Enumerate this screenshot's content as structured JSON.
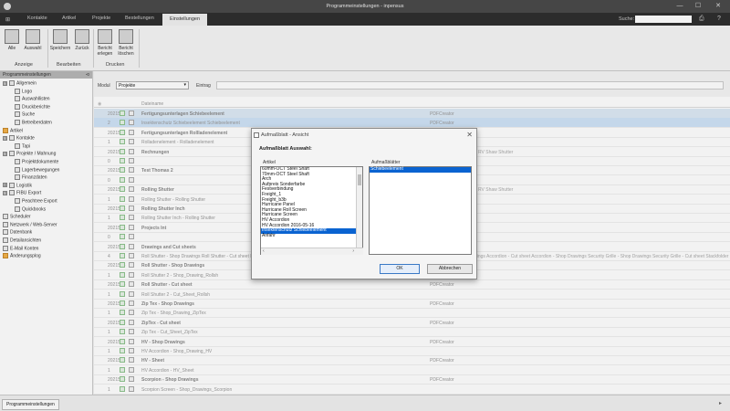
{
  "window": {
    "title": "Programmeinstellungen - inpensus",
    "min": "—",
    "max": "☐",
    "close": "✕"
  },
  "menu": {
    "tabs": [
      "Kontakte",
      "Artikel",
      "Projekte",
      "Bestellungen",
      "Einstellungen"
    ],
    "active_tab": "Einstellungen",
    "search_label": "Suche:",
    "search_value": ""
  },
  "ribbon": {
    "buttons": [
      {
        "label": "Alle"
      },
      {
        "label": "Auswahl"
      },
      {
        "label": "Speichern"
      },
      {
        "label": "Zurück"
      },
      {
        "label": "Bericht erlegen"
      },
      {
        "label": "Bericht löschen"
      }
    ],
    "groups": [
      "Anzeige",
      "Bearbeiten",
      "Drucken"
    ]
  },
  "sidebar": {
    "header": "Programmeinstellungen",
    "pin": "⊲",
    "tree": [
      {
        "label": "Allgemein",
        "level": 0,
        "toggle": "⊟"
      },
      {
        "label": "Logo",
        "level": 1
      },
      {
        "label": "Auswahllisten",
        "level": 1
      },
      {
        "label": "Druckberichte",
        "level": 1
      },
      {
        "label": "Suche",
        "level": 1
      },
      {
        "label": "Betreiberdaten",
        "level": 1
      },
      {
        "label": "Artikel",
        "level": 0,
        "orange": true
      },
      {
        "label": "Kontakte",
        "level": 0,
        "toggle": "⊟"
      },
      {
        "label": "Tapi",
        "level": 1
      },
      {
        "label": "Projekte / Mahnung",
        "level": 0,
        "toggle": "⊟"
      },
      {
        "label": "Projektdokumente",
        "level": 1
      },
      {
        "label": "Lagerbewegungen",
        "level": 1
      },
      {
        "label": "Finanzdaten",
        "level": 1
      },
      {
        "label": "Logistik",
        "level": 0,
        "toggle": "⊞"
      },
      {
        "label": "FIBU Export",
        "level": 0,
        "toggle": "⊟"
      },
      {
        "label": "Peachtree Export",
        "level": 1
      },
      {
        "label": "Quickbooks",
        "level": 1
      },
      {
        "label": "Scheduler",
        "level": 0
      },
      {
        "label": "Netzwerk / Web-Server",
        "level": 0
      },
      {
        "label": "Datenbank",
        "level": 0
      },
      {
        "label": "Detailansichten",
        "level": 0
      },
      {
        "label": "E-Mail Konten",
        "level": 0
      },
      {
        "label": "Änderungsplog",
        "level": 0,
        "orange": true
      }
    ]
  },
  "filter": {
    "module_label": "Modul",
    "module_value": "Projekte",
    "entry_label": "Eintrag",
    "column_header": "Dateiname"
  },
  "grid": {
    "rows": [
      {
        "id": "2021508",
        "name": "Fertigungsunterlagen Schiebeelement",
        "creator": "PDFCreator",
        "extra": "",
        "bold": true,
        "state": "hl"
      },
      {
        "id": "2",
        "name": "Insektenschutz Schiebeelement Schiebeelement",
        "creator": "PDFCreator",
        "extra": "",
        "bold": false,
        "state": "sel"
      },
      {
        "id": "2021508",
        "name": "Fertigungsunterlagen Rollladenelement",
        "creator": "PDFCreator",
        "extra": "",
        "bold": true,
        "state": ""
      },
      {
        "id": "1",
        "name": "Rolladenelement - Rolladenelement",
        "creator": "",
        "extra": "",
        "bold": false,
        "state": ""
      },
      {
        "id": "2021508",
        "name": "Rechnungen",
        "creator": "",
        "extra": "HP C-3000 RV Shaw Shutter",
        "bold": true,
        "state": ""
      },
      {
        "id": "0",
        "name": "",
        "creator": "",
        "extra": "",
        "bold": false,
        "state": ""
      },
      {
        "id": "2021508",
        "name": "Test Thomas 2",
        "creator": "",
        "extra": "",
        "bold": true,
        "state": ""
      },
      {
        "id": "0",
        "name": "",
        "creator": "",
        "extra": "",
        "bold": false,
        "state": ""
      },
      {
        "id": "2021508",
        "name": "Rolling Shutter",
        "creator": "PDFCreator",
        "extra": "HP C-3000 RV Shaw Shutter",
        "bold": true,
        "state": ""
      },
      {
        "id": "1",
        "name": "Rolling Shutter - Rolling Shutter",
        "creator": "",
        "extra": "",
        "bold": false,
        "state": ""
      },
      {
        "id": "2021508",
        "name": "Rolling Shutter Inch",
        "creator": "PDFCreator",
        "extra": "",
        "bold": true,
        "state": ""
      },
      {
        "id": "1",
        "name": "Rolling Shutter Inch - Rolling Shutter",
        "creator": "",
        "extra": "",
        "bold": false,
        "state": ""
      },
      {
        "id": "2021508",
        "name": "Projects Int",
        "creator": "",
        "extra": "",
        "bold": true,
        "state": ""
      },
      {
        "id": "0",
        "name": "",
        "creator": "",
        "extra": "",
        "bold": false,
        "state": ""
      },
      {
        "id": "2021508",
        "name": "Drawings and Cut sheets",
        "creator": "",
        "extra": "",
        "bold": true,
        "state": ""
      },
      {
        "id": "4",
        "name": "Roll Shutter - Shop Drawings Roll Shutter - Cut sheet Roll Shutter",
        "creator": "",
        "extra": "Shop Drawings Accordion - Cut sheet Accordion - Shop Drawings Security Grille - Shop Drawings Security Grille - Cut sheet Stackfolder - Shop Drawings",
        "bold": false,
        "state": ""
      },
      {
        "id": "2021508",
        "name": "Roll Shutter - Shop Drawings",
        "creator": "PDFCreator",
        "extra": "",
        "bold": true,
        "state": ""
      },
      {
        "id": "1",
        "name": "Roll Shutter 2 - Shop_Drawing_Rollsh",
        "creator": "",
        "extra": "",
        "bold": false,
        "state": ""
      },
      {
        "id": "2021508",
        "name": "Roll Shutter - Cut sheet",
        "creator": "PDFCreator",
        "extra": "",
        "bold": true,
        "state": ""
      },
      {
        "id": "1",
        "name": "Roll Shutter 2 - Cut_Sheet_Rollsh",
        "creator": "",
        "extra": "",
        "bold": false,
        "state": ""
      },
      {
        "id": "2021508",
        "name": "Zip Tex - Shop Drawings",
        "creator": "PDFCreator",
        "extra": "",
        "bold": true,
        "state": ""
      },
      {
        "id": "1",
        "name": "Zip Tex - Shop_Drawing_ZipTex",
        "creator": "",
        "extra": "",
        "bold": false,
        "state": ""
      },
      {
        "id": "2021508",
        "name": "ZipTex - Cut sheet",
        "creator": "PDFCreator",
        "extra": "",
        "bold": true,
        "state": ""
      },
      {
        "id": "1",
        "name": "Zip Tex - Cut_Sheet_ZipTex",
        "creator": "",
        "extra": "",
        "bold": false,
        "state": ""
      },
      {
        "id": "2021508",
        "name": "HV - Shop Drawings",
        "creator": "PDFCreator",
        "extra": "",
        "bold": true,
        "state": ""
      },
      {
        "id": "1",
        "name": "HV Accordion - Shop_Drawing_HV",
        "creator": "",
        "extra": "",
        "bold": false,
        "state": ""
      },
      {
        "id": "2021508",
        "name": "HV - Sheet",
        "creator": "PDFCreator",
        "extra": "",
        "bold": true,
        "state": ""
      },
      {
        "id": "1",
        "name": "HV Accordion - HV_Sheet",
        "creator": "",
        "extra": "",
        "bold": false,
        "state": ""
      },
      {
        "id": "2021508",
        "name": "Scorpion - Shop Drawings",
        "creator": "PDFCreator",
        "extra": "",
        "bold": true,
        "state": ""
      },
      {
        "id": "1",
        "name": "Scorpion Screen - Shop_Drawings_Scorpion",
        "creator": "",
        "extra": "",
        "bold": false,
        "state": ""
      }
    ]
  },
  "dialog": {
    "title": "Aufmaßblatt - Ansicht",
    "close": "✕",
    "subtitle": "Aufmaßblatt Auswahl:",
    "left_label": "Artikel",
    "right_label": "Aufmaßblätter",
    "articles": [
      "60mm-OCT Steel Shaft",
      "70mm-OCT Steel Shaft",
      "Arch",
      "Aufpreis Sonderfarbe",
      "Festverbindung",
      "Freight_1",
      "Freight_b3b",
      "Hurricane Panel",
      "Hurricane Roll Screen",
      "Hurricane Screen",
      "HV Accordion",
      "HV Accordion 2016-05-16",
      "Insektenschutz Schiebeelement",
      "Anfahr"
    ],
    "selected_article": "Insektenschutz Schiebeelement",
    "sheets": [
      "Schiebeelement"
    ],
    "selected_sheet": "Schiebeelement",
    "ok_label": "OK",
    "cancel_label": "Abbrechen"
  },
  "status": {
    "tab_label": "Programmeinstellungen"
  }
}
